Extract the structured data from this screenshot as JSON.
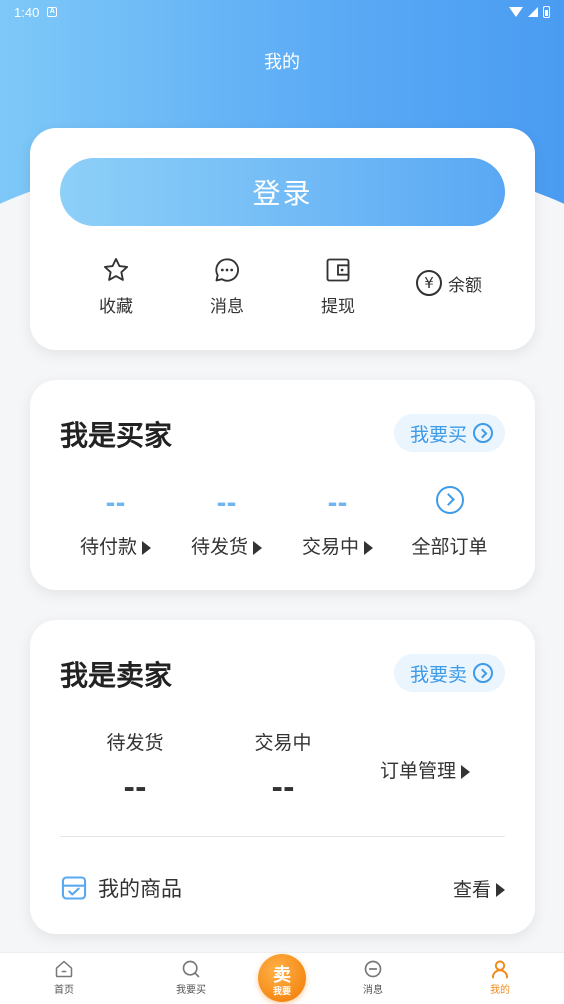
{
  "status": {
    "time": "1:40",
    "notif": "A"
  },
  "header": {
    "title": "我的"
  },
  "login_card": {
    "login_label": "登录",
    "quick": [
      {
        "icon": "star-icon",
        "label": "收藏"
      },
      {
        "icon": "chat-icon",
        "label": "消息"
      },
      {
        "icon": "wallet-icon",
        "label": "提现"
      }
    ],
    "balance": {
      "symbol": "¥",
      "label": "余额"
    }
  },
  "buyer": {
    "title": "我是买家",
    "action_label": "我要买",
    "orders": [
      {
        "count": "--",
        "label": "待付款"
      },
      {
        "count": "--",
        "label": "待发货"
      },
      {
        "count": "--",
        "label": "交易中"
      }
    ],
    "all_orders_label": "全部订单"
  },
  "seller": {
    "title": "我是卖家",
    "action_label": "我要卖",
    "stats": [
      {
        "label": "待发货",
        "value": "--"
      },
      {
        "label": "交易中",
        "value": "--"
      }
    ],
    "order_mgmt_label": "订单管理",
    "goods_label": "我的商品",
    "goods_view_label": "查看"
  },
  "tabbar": {
    "tabs": [
      {
        "label": "首页"
      },
      {
        "label": "我要买"
      },
      {
        "label": "消息"
      },
      {
        "label": "我的"
      }
    ],
    "fab_big": "卖",
    "fab_small": "我要",
    "active_color": "#f28a1c"
  },
  "colors": {
    "accent": "#3e9be8",
    "header_blue": "#5aaaf5"
  }
}
